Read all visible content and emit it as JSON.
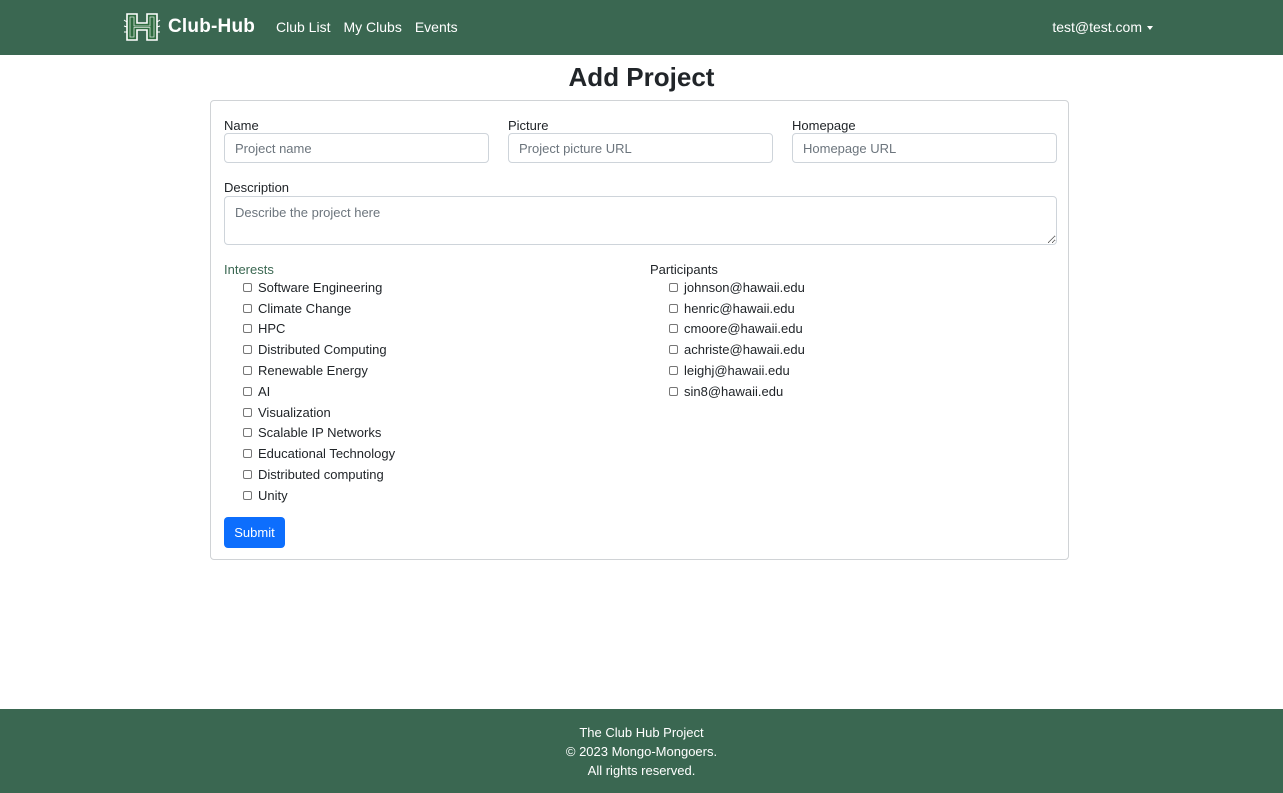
{
  "nav": {
    "brand": "Club-Hub",
    "links": [
      "Club List",
      "My Clubs",
      "Events"
    ],
    "user": "test@test.com"
  },
  "page": {
    "title": "Add Project"
  },
  "form": {
    "name": {
      "label": "Name",
      "placeholder": "Project name",
      "value": ""
    },
    "picture": {
      "label": "Picture",
      "placeholder": "Project picture URL",
      "value": ""
    },
    "homepage": {
      "label": "Homepage",
      "placeholder": "Homepage URL",
      "value": ""
    },
    "description": {
      "label": "Description",
      "placeholder": "Describe the project here",
      "value": ""
    },
    "interests": {
      "label": "Interests",
      "options": [
        "Software Engineering",
        "Climate Change",
        "HPC",
        "Distributed Computing",
        "Renewable Energy",
        "AI",
        "Visualization",
        "Scalable IP Networks",
        "Educational Technology",
        "Distributed computing",
        "Unity"
      ]
    },
    "participants": {
      "label": "Participants",
      "options": [
        "johnson@hawaii.edu",
        "henric@hawaii.edu",
        "cmoore@hawaii.edu",
        "achriste@hawaii.edu",
        "leighj@hawaii.edu",
        "sin8@hawaii.edu"
      ]
    },
    "submit_label": "Submit"
  },
  "footer": {
    "line1": "The Club Hub Project",
    "line2": "© 2023 Mongo-Mongoers.",
    "line3": "All rights reserved."
  },
  "colors": {
    "nav_bg": "#3a6751",
    "accent": "#0d6efd",
    "interests_label": "#3a6751"
  }
}
